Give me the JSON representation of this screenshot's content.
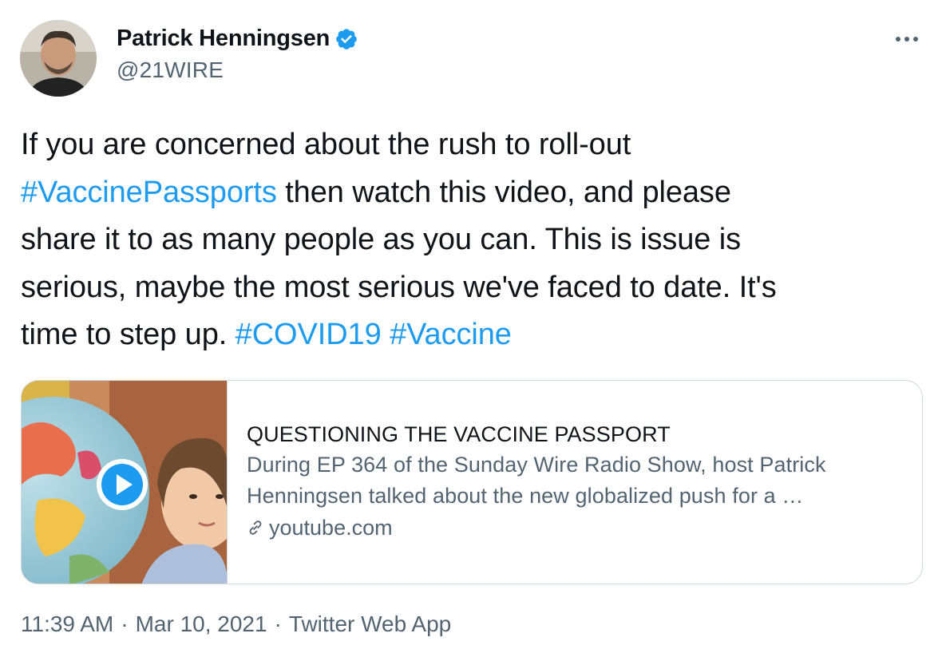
{
  "author": {
    "display_name": "Patrick Henningsen",
    "handle": "@21WIRE",
    "verified_icon": "verified-badge-icon",
    "avatar_icon": "avatar-photo"
  },
  "tweet": {
    "lines": [
      [
        {
          "text": "If you are concerned about the rush to roll-out",
          "type": "text"
        }
      ],
      [
        {
          "text": "#VaccinePassports",
          "type": "hashtag"
        },
        {
          "text": " then watch this video, and please",
          "type": "text"
        }
      ],
      [
        {
          "text": "share it to as many people as you can. This is issue is",
          "type": "text"
        }
      ],
      [
        {
          "text": "serious, maybe the most serious we've faced to date. It's",
          "type": "text"
        }
      ],
      [
        {
          "text": "time to step up. ",
          "type": "text"
        },
        {
          "text": "#COVID19",
          "type": "hashtag"
        },
        {
          "text": " ",
          "type": "text"
        },
        {
          "text": "#Vaccine",
          "type": "hashtag"
        }
      ]
    ]
  },
  "card": {
    "title": "QUESTIONING THE VACCINE PASSPORT",
    "description_lines": [
      "During EP 364 of the Sunday Wire Radio Show, host Patrick",
      "Henningsen talked about the new globalized push for a …"
    ],
    "domain": "youtube.com",
    "play_icon": "play-button-icon",
    "link_icon": "link-icon"
  },
  "meta": {
    "time": "11:39 AM",
    "separator": "·",
    "date": "Mar 10, 2021",
    "source": "Twitter Web App"
  },
  "colors": {
    "accent": "#1d9bf0",
    "text": "#0f1419",
    "secondary": "#536471",
    "border": "#cfd9de"
  }
}
